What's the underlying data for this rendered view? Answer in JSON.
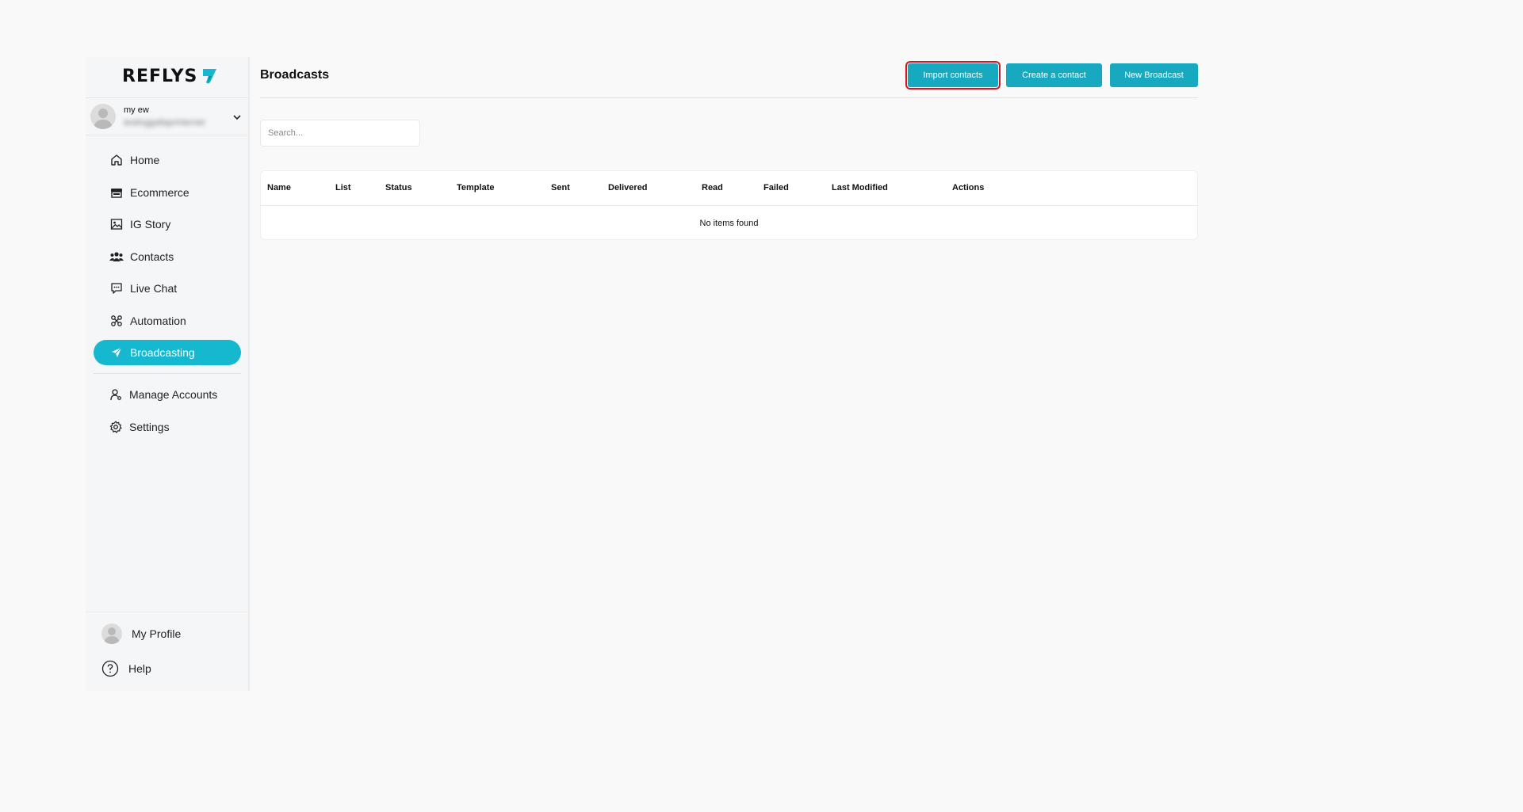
{
  "brand": {
    "name": "REFLYS",
    "accent": "#16b8d0"
  },
  "account": {
    "name": "my ew",
    "email": "testinggallaprinternet"
  },
  "nav": [
    {
      "label": "Home",
      "icon": "home-icon",
      "active": false
    },
    {
      "label": "Ecommerce",
      "icon": "store-icon",
      "active": false
    },
    {
      "label": "IG Story",
      "icon": "image-icon",
      "active": false
    },
    {
      "label": "Contacts",
      "icon": "users-icon",
      "active": false
    },
    {
      "label": "Live Chat",
      "icon": "chat-icon",
      "active": false
    },
    {
      "label": "Automation",
      "icon": "automation-icon",
      "active": false
    },
    {
      "label": "Broadcasting",
      "icon": "send-icon",
      "active": true
    }
  ],
  "nav2": [
    {
      "label": "Manage Accounts",
      "icon": "user-key-icon"
    },
    {
      "label": "Settings",
      "icon": "gear-icon"
    }
  ],
  "footer": {
    "profile": "My Profile",
    "help": "Help"
  },
  "page": {
    "title": "Broadcasts",
    "buttons": {
      "import": "Import contacts",
      "create": "Create a contact",
      "new": "New Broadcast"
    },
    "search_placeholder": "Search..."
  },
  "table": {
    "columns": [
      "Name",
      "List",
      "Status",
      "Template",
      "Sent",
      "Delivered",
      "Read",
      "Failed",
      "Last Modified",
      "Actions"
    ],
    "empty_text": "No items found"
  }
}
